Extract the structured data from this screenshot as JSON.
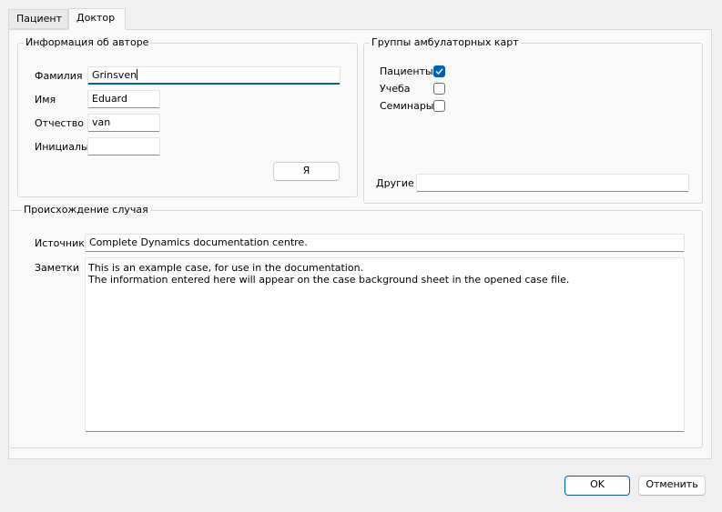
{
  "tabs": [
    {
      "label": "Пациент",
      "active": false
    },
    {
      "label": "Доктор",
      "active": true
    }
  ],
  "author_info": {
    "title": "Информация об авторе",
    "surname_label": "Фамилия",
    "surname_value": "Grinsven",
    "name_label": "Имя",
    "name_value": "Eduard",
    "patronymic_label": "Отчество",
    "patronymic_value": "van",
    "initials_label": "Инициалы",
    "initials_value": "",
    "me_button": "Я"
  },
  "card_groups": {
    "title": "Группы амбулаторных карт",
    "items": [
      {
        "label": "Пациенты",
        "checked": true
      },
      {
        "label": "Учеба",
        "checked": false
      },
      {
        "label": "Семинары",
        "checked": false
      }
    ],
    "other_label": "Другие",
    "other_value": ""
  },
  "case_origin": {
    "title": "Происхождение случая",
    "source_label": "Источник",
    "source_value": "Complete Dynamics documentation centre.",
    "notes_label": "Заметки",
    "notes_value": "This is an example case, for use in the documentation.\nThe information entered here will appear on the case background sheet in the opened case file."
  },
  "dialog_buttons": {
    "ok": "OK",
    "cancel": "Отменить"
  },
  "colors": {
    "accent": "#005fb8"
  }
}
